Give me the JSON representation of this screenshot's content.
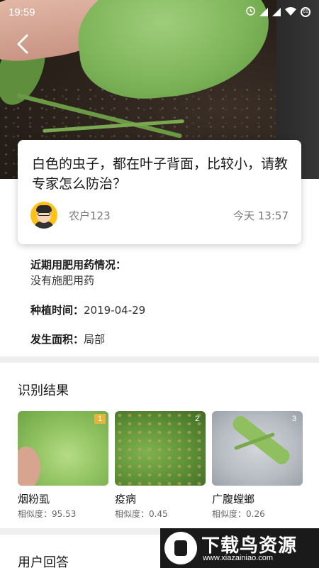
{
  "status_bar": {
    "time": "19:59",
    "battery": "61"
  },
  "question": {
    "title": "白色的虫子，都在叶子背面，比较小，请教专家怎么防治？",
    "user": "农户123",
    "time": "今天 13:57"
  },
  "details": {
    "fertilizer_label": "近期用肥用药情况：",
    "fertilizer_value": "没有施肥用药",
    "plant_time_label": "种植时间：",
    "plant_time_value": "2019-04-29",
    "area_label": "发生面积：",
    "area_value": "局部"
  },
  "results": {
    "title": "识别结果",
    "items": [
      {
        "rank": "1",
        "name": "烟粉虱",
        "similarity": "相似度：95.53"
      },
      {
        "rank": "2",
        "name": "疫病",
        "similarity": "相似度：0.45"
      },
      {
        "rank": "3",
        "name": "广腹螳螂",
        "similarity": "相似度：0.26"
      }
    ]
  },
  "answers": {
    "title": "用户回答"
  },
  "watermark": {
    "text": "下载鸟资源",
    "url": "www.xiazainiao.com"
  },
  "colors": {
    "rank1_badge": "#e3b53a",
    "divider": "#efefef",
    "avatar_bg": "#ffc21a"
  },
  "icons": [
    "back-arrow-icon",
    "clock-icon",
    "signal-icon",
    "wifi-icon",
    "battery-icon"
  ]
}
